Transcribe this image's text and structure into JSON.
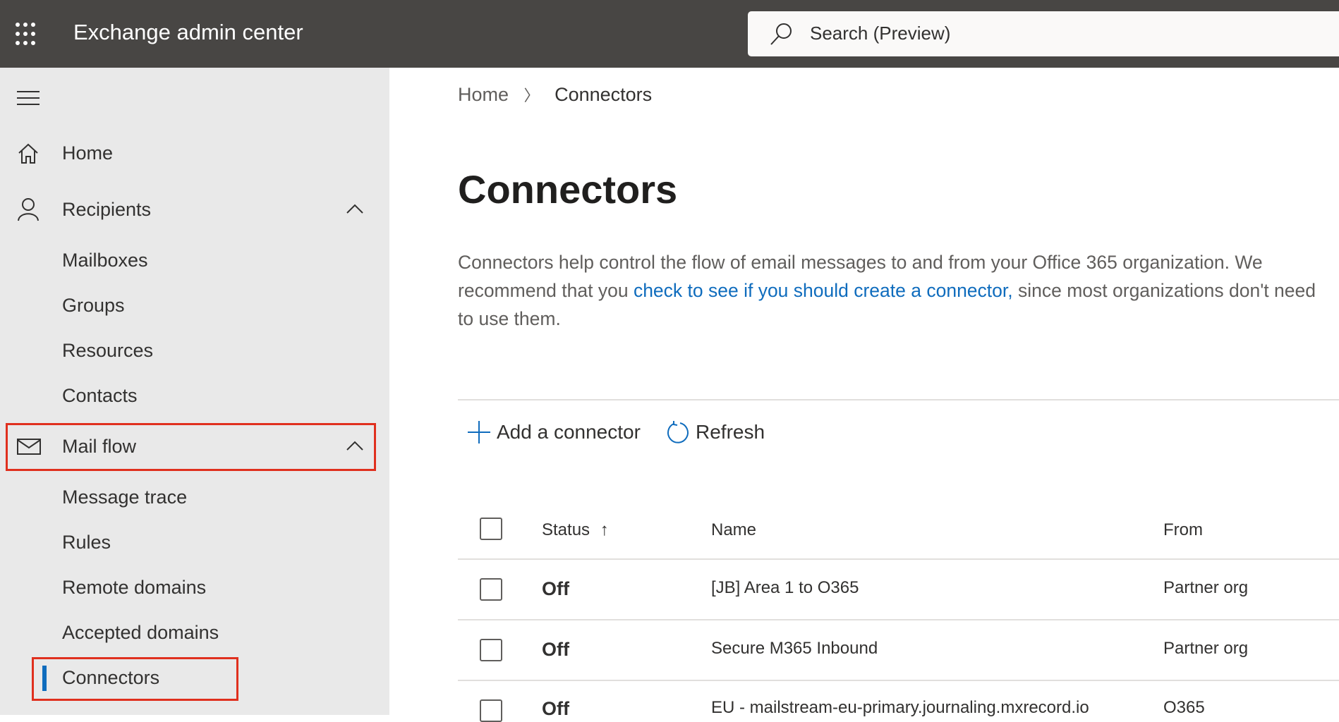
{
  "header": {
    "app_title": "Exchange admin center",
    "search_placeholder": "Search (Preview)"
  },
  "sidebar": {
    "items": [
      {
        "label": "Home"
      },
      {
        "label": "Recipients"
      },
      {
        "label": "Mailboxes"
      },
      {
        "label": "Groups"
      },
      {
        "label": "Resources"
      },
      {
        "label": "Contacts"
      },
      {
        "label": "Mail flow"
      },
      {
        "label": "Message trace"
      },
      {
        "label": "Rules"
      },
      {
        "label": "Remote domains"
      },
      {
        "label": "Accepted domains"
      },
      {
        "label": "Connectors"
      }
    ]
  },
  "breadcrumb": {
    "home": "Home",
    "current": "Connectors"
  },
  "page": {
    "title": "Connectors",
    "desc_before": "Connectors help control the flow of email messages to and from your Office 365 organization. We recommend that you ",
    "desc_link": "check to see if you should create a connector,",
    "desc_after": " since most organizations don't need to use them."
  },
  "toolbar": {
    "add": "Add a connector",
    "refresh": "Refresh"
  },
  "table": {
    "headers": {
      "status": "Status",
      "name": "Name",
      "from": "From"
    },
    "rows": [
      {
        "status": "Off",
        "name": "[JB] Area 1 to O365",
        "from": "Partner org"
      },
      {
        "status": "Off",
        "name": "Secure M365 Inbound",
        "from": "Partner org"
      },
      {
        "status": "Off",
        "name": "EU - mailstream-eu-primary.journaling.mxrecord.io",
        "from": "O365"
      }
    ]
  },
  "colors": {
    "accent": "#0f6cbd",
    "highlight": "#e0301e",
    "topbar": "#484644"
  }
}
